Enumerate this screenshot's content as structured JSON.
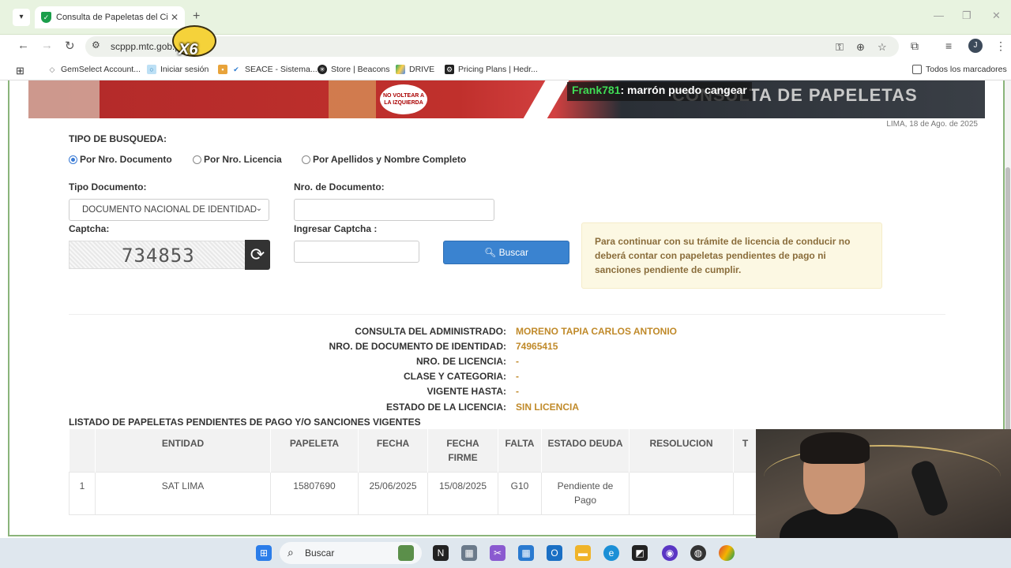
{
  "browser": {
    "tab_title": "Consulta de Papeletas del Ciud...",
    "url": "scppp.mtc.gob.pe",
    "avatar_letter": "J",
    "bookmarks": [
      {
        "label": "GemSelect Account..."
      },
      {
        "label": "Iniciar sesión"
      },
      {
        "label": "SEACE - Sistema..."
      },
      {
        "label": "Store | Beacons"
      },
      {
        "label": "DRIVE"
      },
      {
        "label": "Pricing Plans | Hedr..."
      }
    ],
    "all_bookmarks": "Todos los marcadores"
  },
  "stream": {
    "sticker_text": "X6",
    "chat_user": "Frank781",
    "chat_message": ": marrón puedo cangear"
  },
  "banner": {
    "title": "CONSULTA DE PAPELETAS",
    "sign_text": "NO VOLTEAR A LA IZQUIERDA"
  },
  "page": {
    "date": "LIMA, 18 de Ago. de 2025",
    "search_type_label": "TIPO DE BUSQUEDA:",
    "radios": [
      {
        "label": "Por Nro. Documento",
        "checked": true
      },
      {
        "label": "Por Nro. Licencia",
        "checked": false
      },
      {
        "label": "Por Apellidos y Nombre Completo",
        "checked": false
      }
    ],
    "doc_type_label": "Tipo Documento:",
    "doc_type_value": "DOCUMENTO NACIONAL DE IDENTIDAD",
    "doc_number_label": "Nro. de Documento:",
    "doc_number_value": "",
    "captcha_label": "Captcha:",
    "captcha_value": "734853",
    "captcha_input_label": "Ingresar Captcha :",
    "captcha_input_value": "",
    "search_button": "Buscar",
    "alert": "Para continuar con su trámite de licencia de conducir no deberá contar con papeletas pendientes de pago ni sanciones pendiente de cumplir."
  },
  "result": {
    "rows": [
      {
        "key": "CONSULTA DEL ADMINISTRADO:",
        "value": "MORENO TAPIA CARLOS ANTONIO"
      },
      {
        "key": "NRO. DE DOCUMENTO DE IDENTIDAD:",
        "value": "74965415"
      },
      {
        "key": "NRO. DE LICENCIA:",
        "value": "-"
      },
      {
        "key": "CLASE Y CATEGORIA:",
        "value": "-"
      },
      {
        "key": "VIGENTE HASTA:",
        "value": "-"
      },
      {
        "key": "ESTADO DE LA LICENCIA:",
        "value": "SIN LICENCIA"
      }
    ],
    "list_title": "LISTADO DE PAPELETAS PENDIENTES DE PAGO Y/O SANCIONES VIGENTES",
    "table_headers": [
      "",
      "ENTIDAD",
      "PAPELETA",
      "FECHA",
      "FECHA FIRME",
      "FALTA",
      "ESTADO DEUDA",
      "RESOLUCION",
      "T"
    ],
    "table_rows": [
      [
        "1",
        "SAT LIMA",
        "15807690",
        "25/06/2025",
        "15/08/2025",
        "G10",
        "Pendiente de Pago",
        "",
        ""
      ]
    ]
  },
  "taskbar": {
    "search_placeholder": "Buscar"
  }
}
